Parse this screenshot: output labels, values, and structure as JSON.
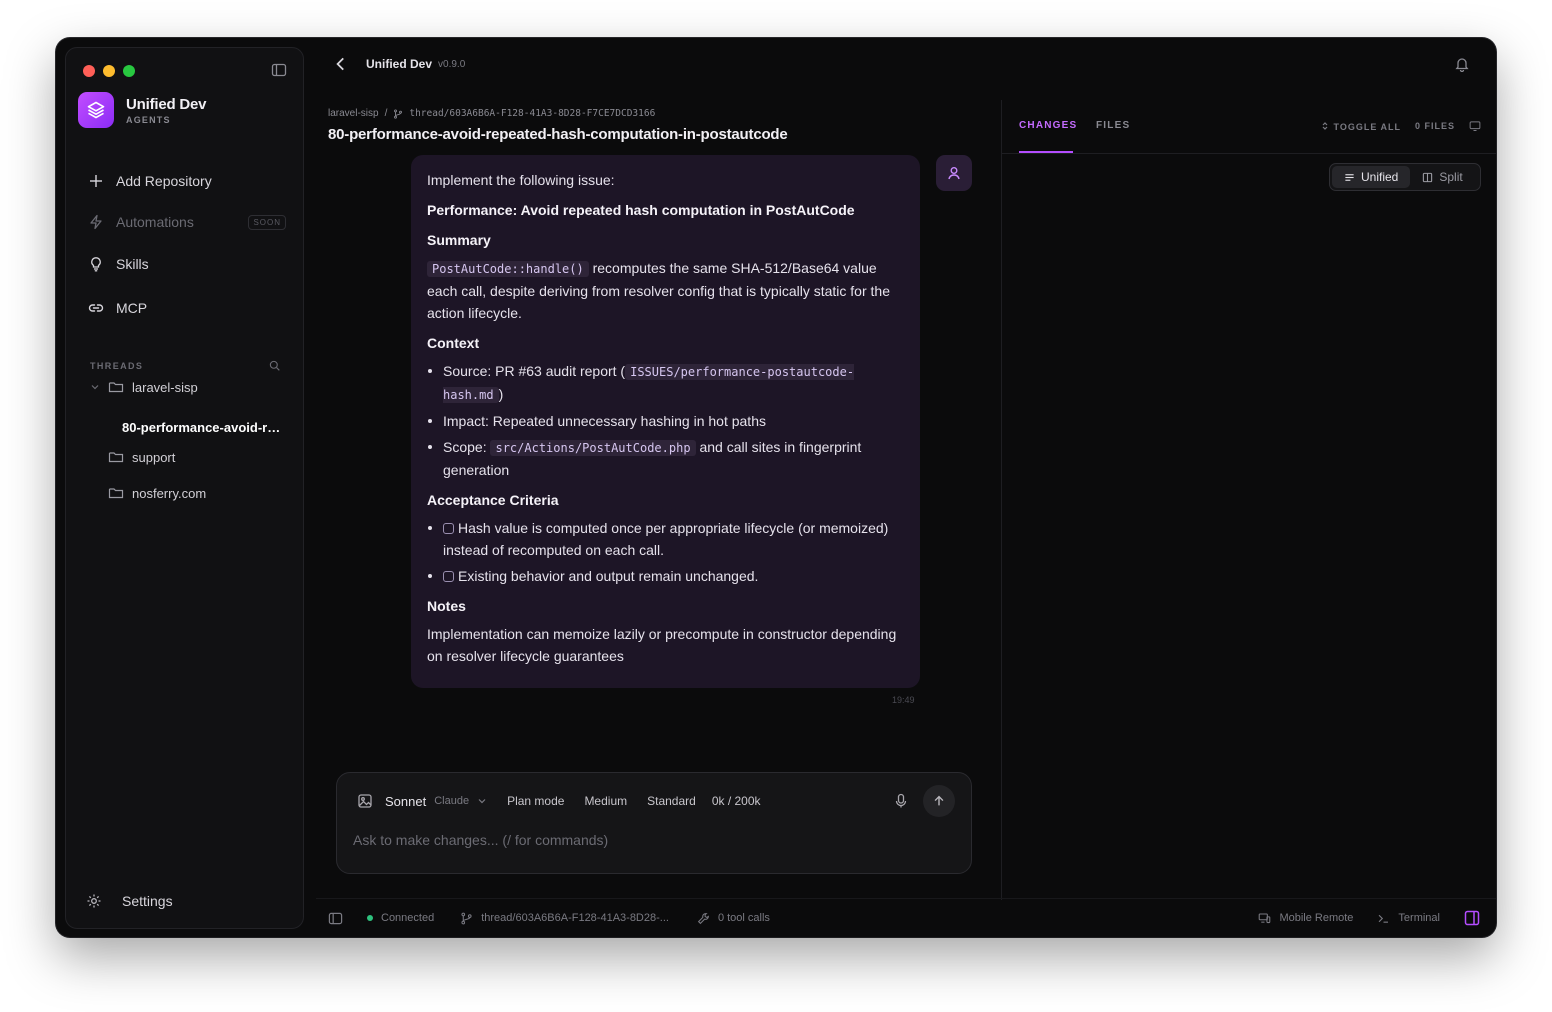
{
  "sidebar": {
    "brand_title": "Unified Dev",
    "brand_subtitle": "AGENTS",
    "nav": {
      "add_repository": "Add Repository",
      "automations": "Automations",
      "automations_badge": "SOON",
      "skills": "Skills",
      "mcp": "MCP"
    },
    "threads_header": "THREADS",
    "repos": [
      {
        "name": "laravel-sisp",
        "expanded": true,
        "threads": [
          "80-performance-avoid-repeated-hash-computation-in-postautcode"
        ]
      },
      {
        "name": "support"
      },
      {
        "name": "nosferry.com"
      }
    ],
    "active_thread": "80-performance-avoid-repeated-hash-computation-in-postautcode",
    "settings": "Settings"
  },
  "topbar": {
    "title": "Unified Dev",
    "version": "v0.9.0"
  },
  "breadcrumb": {
    "repo": "laravel-sisp",
    "separator": "/",
    "thread_id": "thread/603A6B6A-F128-41A3-8D28-F7CE7DCD3166"
  },
  "thread_title": "80-performance-avoid-repeated-hash-computation-in-postautcode",
  "message": {
    "intro": "Implement the following issue:",
    "issue_title": "Performance: Avoid repeated hash computation in PostAutCode",
    "summary_heading": "Summary",
    "summary_code": "PostAutCode::handle()",
    "summary_text": " recomputes the same SHA-512/Base64 value each call, despite deriving from resolver config that is typically static for the action lifecycle.",
    "context_heading": "Context",
    "context": {
      "source_prefix": "Source: PR #63 audit report (",
      "source_code": "ISSUES/performance-postautcode-hash.md",
      "source_suffix": ")",
      "impact": "Impact: Repeated unnecessary hashing in hot paths",
      "scope_prefix": "Scope: ",
      "scope_code": "src/Actions/PostAutCode.php",
      "scope_suffix": " and call sites in fingerprint generation"
    },
    "criteria_heading": "Acceptance Criteria",
    "criteria": [
      "Hash value is computed once per appropriate lifecycle (or memoized) instead of recomputed on each call.",
      "Existing behavior and output remain unchanged."
    ],
    "notes_heading": "Notes",
    "notes_text": "Implementation can memoize lazily or precompute in constructor depending on resolver lifecycle guarantees",
    "timestamp": "19:49"
  },
  "composer": {
    "model": "Sonnet",
    "provider": "Claude",
    "mode": "Plan mode",
    "effort": "Medium",
    "speed": "Standard",
    "context_usage": "0k / 200k",
    "placeholder": "Ask to make changes... (/ for commands)",
    "value": ""
  },
  "right_panel": {
    "tabs": [
      "CHANGES",
      "FILES"
    ],
    "active_tab": "CHANGES",
    "toggle_all": "TOGGLE ALL",
    "files_count": "0 FILES",
    "view_modes": [
      "Unified",
      "Split"
    ],
    "active_view": "Unified"
  },
  "statusbar": {
    "connection": "Connected",
    "thread": "thread/603A6B6A-F128-41A3-8D28-...",
    "tool_calls": "0 tool calls",
    "mobile_remote": "Mobile Remote",
    "terminal": "Terminal"
  },
  "colors": {
    "accent": "#b44dff",
    "message_bg": "#1d1526",
    "window_bg": "#0b0b0c",
    "connected": "#2ec27e"
  },
  "icons": {
    "brand": "layers-icon",
    "add_repository": "plus-icon",
    "automations": "bolt-icon",
    "skills": "lightbulb-icon",
    "mcp": "link-icon",
    "settings": "gear-icon",
    "back": "chevron-left-icon",
    "notifications": "bell-icon",
    "user": "user-icon",
    "attach": "image-icon",
    "mic": "microphone-icon",
    "send": "arrow-up-icon"
  }
}
